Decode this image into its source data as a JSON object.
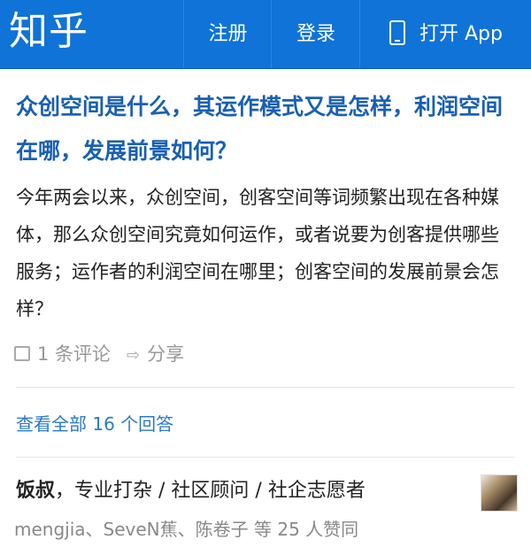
{
  "topbar": {
    "logo": "知乎",
    "register": "注册",
    "login": "登录",
    "open_app": "打开 App"
  },
  "question": {
    "title": "众创空间是什么，其运作模式又是怎样，利润空间在哪，发展前景如何？",
    "body": "今年两会以来，众创空间，创客空间等词频繁出现在各种媒体，那么众创空间究竟如何运作，或者说要为创客提供哪些服务；运作者的利润空间在哪里；创客空间的发展前景会怎样？",
    "comments": "1 条评论",
    "share": "分享"
  },
  "view_all": "查看全部 16 个回答",
  "answer": {
    "author": "饭叔",
    "bio": "，专业打杂 / 社区顾问 / 社企志愿者",
    "voters": "mengjia、SeveN蕉、陈卷子 等 25 人赞同"
  }
}
